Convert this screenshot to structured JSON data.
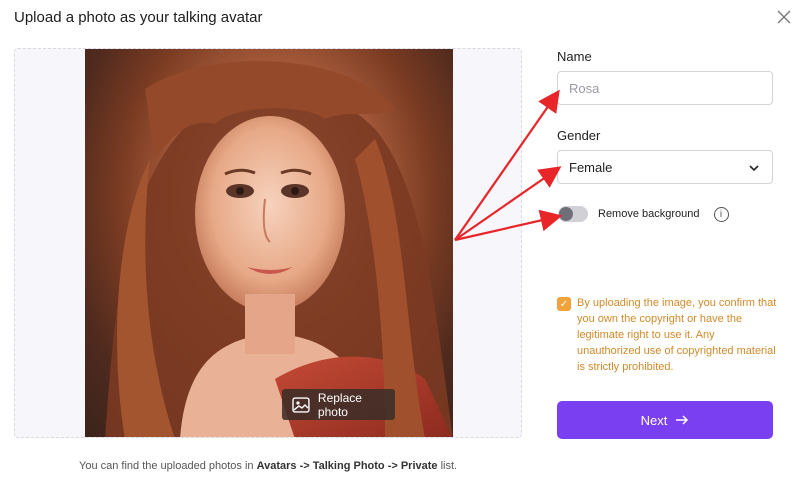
{
  "dialog": {
    "title": "Upload a photo as your talking avatar",
    "close_icon": "close-icon"
  },
  "photo_area": {
    "replace_label": "Replace photo",
    "replace_icon": "image-icon"
  },
  "form": {
    "name_label": "Name",
    "name_placeholder": "Rosa",
    "gender_label": "Gender",
    "gender_value": "Female",
    "remove_bg_label": "Remove background",
    "remove_bg_on": false,
    "consent_checked": true,
    "consent_text": "By uploading the image, you confirm that you own the copyright or have the legitimate right to use it. Any unauthorized use of copyrighted material is strictly prohibited.",
    "next_label": "Next"
  },
  "footer": {
    "prefix": "You can find the uploaded photos in ",
    "path_1": "Avatars",
    "sep_1": " -> ",
    "path_2": "Talking Photo",
    "sep_2": " -> ",
    "path_3": "Private",
    "suffix": " list."
  },
  "colors": {
    "accent": "#7b3ff2",
    "consent": "#d18a2b",
    "annotation_arrow": "#e8262a"
  }
}
